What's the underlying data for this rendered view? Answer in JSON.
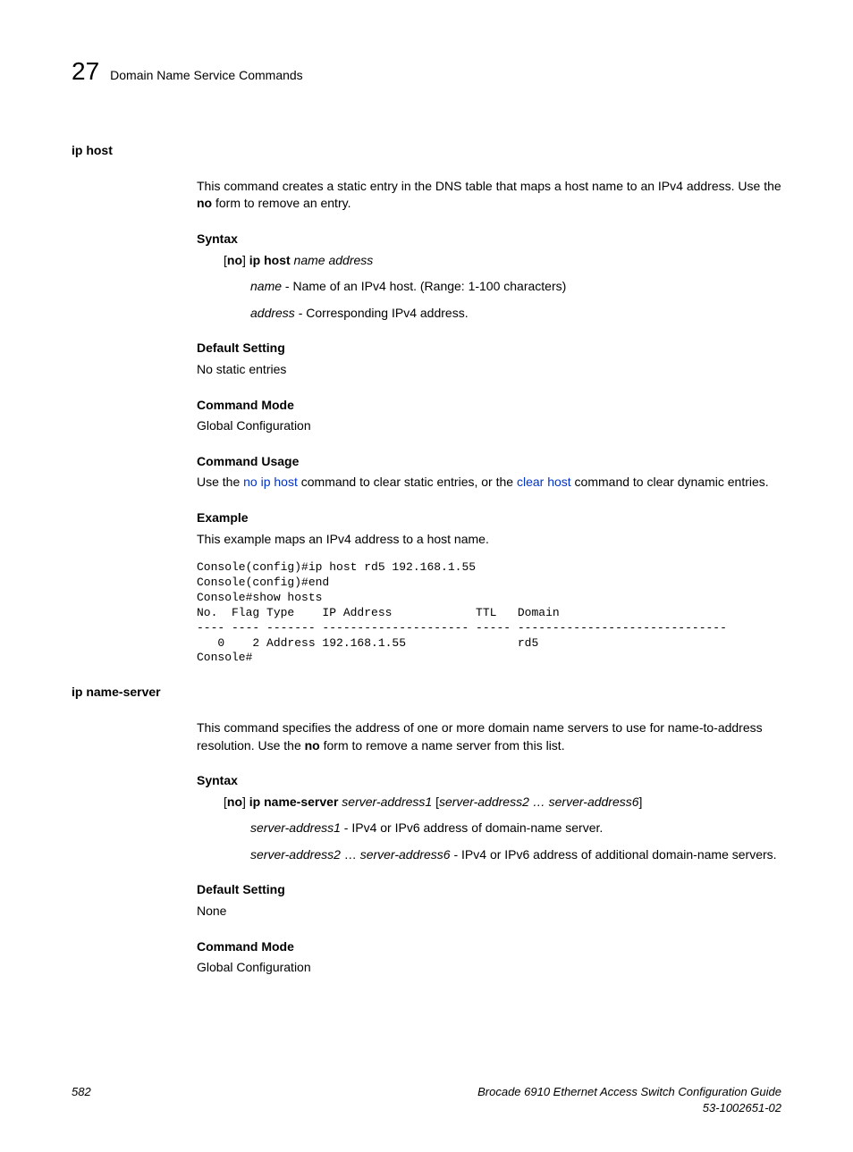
{
  "header": {
    "chapter_num": "27",
    "chapter_title": "Domain Name Service Commands"
  },
  "section1": {
    "title": "ip host",
    "intro_a": "This command creates a static entry in the DNS table that maps a host name to an IPv4 address. Use the ",
    "intro_b": "no",
    "intro_c": " form to remove an entry.",
    "syntax_h": "Syntax",
    "syntax_open": "[",
    "syntax_no": "no",
    "syntax_close": "] ",
    "syntax_cmd": "ip host",
    "syntax_args": " name address",
    "param1_name": "name",
    "param1_desc": " - Name of an IPv4 host. (Range: 1-100 characters)",
    "param2_name": "address",
    "param2_desc": " - Corresponding IPv4 address.",
    "default_h": "Default Setting",
    "default_v": "No static entries",
    "mode_h": "Command Mode",
    "mode_v": "Global Configuration",
    "usage_h": "Command Usage",
    "usage_a": "Use the ",
    "usage_link1": "no ip host",
    "usage_b": " command to clear static entries, or the ",
    "usage_link2": "clear host",
    "usage_c": " command to clear dynamic entries.",
    "example_h": "Example",
    "example_intro": "This example maps an IPv4 address to a host name.",
    "code": "Console(config)#ip host rd5 192.168.1.55\nConsole(config)#end\nConsole#show hosts\nNo.  Flag Type    IP Address            TTL   Domain\n---- ---- ------- --------------------- ----- ------------------------------\n   0    2 Address 192.168.1.55                rd5\nConsole#"
  },
  "section2": {
    "title": "ip name-server",
    "intro_a": "This command specifies the address of one or more domain name servers to use for name-to-address resolution. Use the ",
    "intro_b": "no",
    "intro_c": " form to remove a name server from this list.",
    "syntax_h": "Syntax",
    "syntax_open": "[",
    "syntax_no": "no",
    "syntax_close": "] ",
    "syntax_cmd": "ip name-server",
    "syntax_arg1": " server-address1",
    "syntax_mid": " [",
    "syntax_arg2": "server-address2 … server-address6",
    "syntax_end": "]",
    "param1_name": "server-address1",
    "param1_desc": " - IPv4 or IPv6 address of domain-name server.",
    "param2_name": "server-address2",
    "param2_mid": " … ",
    "param2_name2": "server-address6",
    "param2_desc": " - IPv4 or IPv6 address of additional domain-name servers.",
    "default_h": "Default Setting",
    "default_v": "None",
    "mode_h": "Command Mode",
    "mode_v": "Global Configuration"
  },
  "footer": {
    "page": "582",
    "doc_title": "Brocade 6910 Ethernet Access Switch Configuration Guide",
    "doc_num": "53-1002651-02"
  }
}
